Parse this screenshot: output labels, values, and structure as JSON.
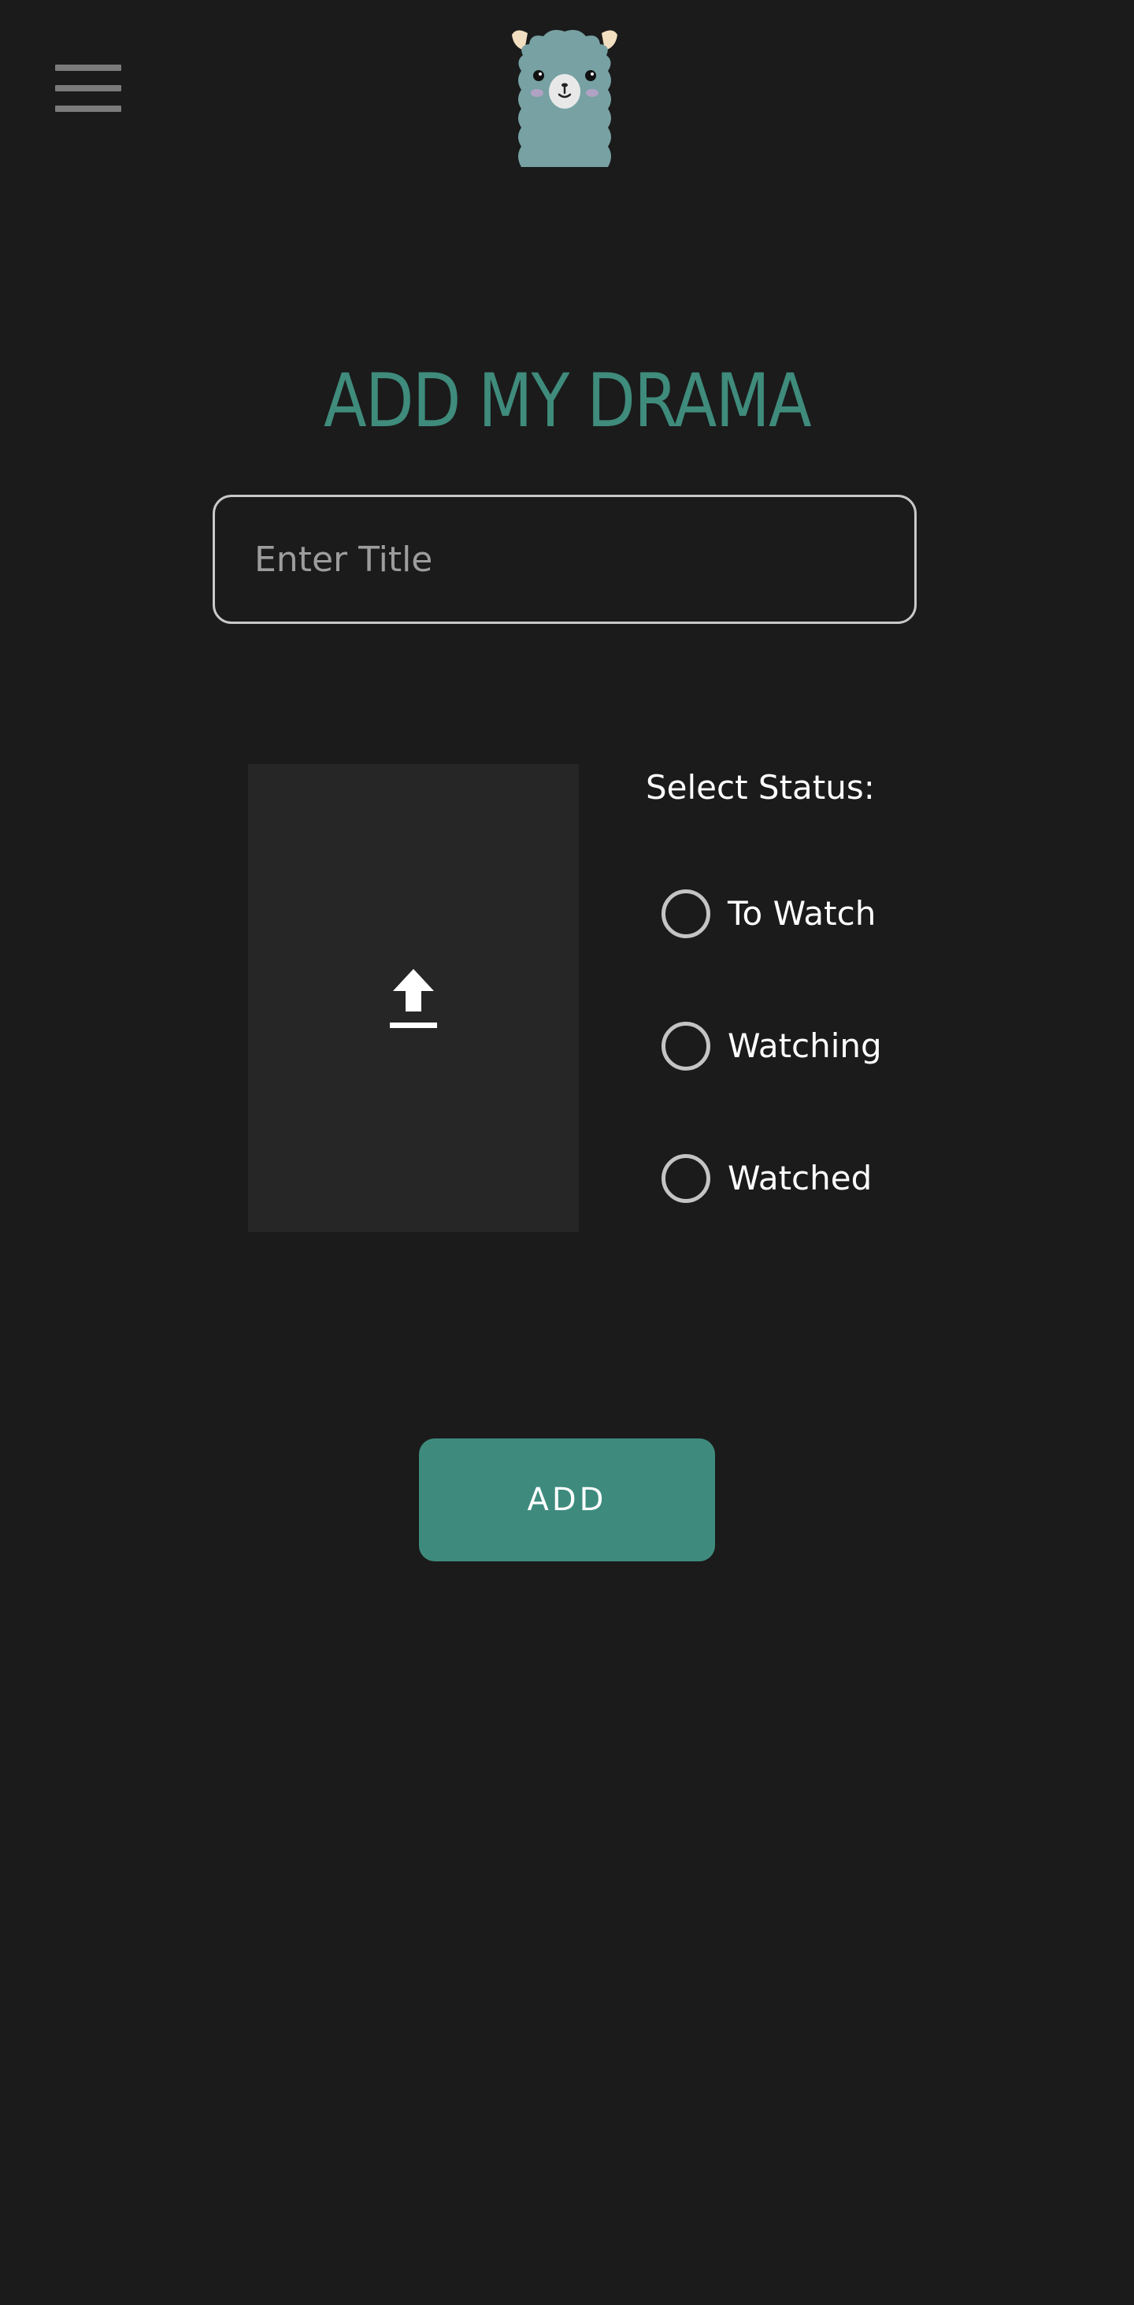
{
  "header": {
    "menu_icon": "hamburger-icon",
    "logo_icon": "alpaca-logo"
  },
  "main": {
    "title": "ADD MY DRAMA",
    "title_input": {
      "placeholder": "Enter Title",
      "value": ""
    },
    "upload": {
      "icon": "upload-icon"
    },
    "status": {
      "label": "Select Status:",
      "options": [
        {
          "label": "To Watch",
          "selected": false
        },
        {
          "label": "Watching",
          "selected": false
        },
        {
          "label": "Watched",
          "selected": false
        }
      ]
    },
    "add_label": "ADD"
  },
  "colors": {
    "background": "#1b1b1b",
    "accent": "#3e8b7e",
    "upload_panel": "#262626",
    "border": "#c9c9c9"
  }
}
